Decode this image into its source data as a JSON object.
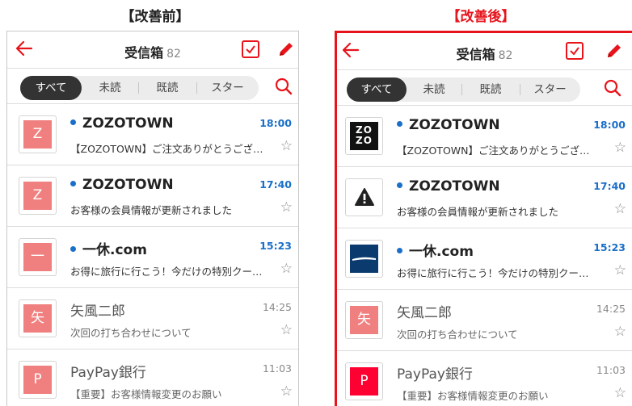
{
  "captions": {
    "before": "【改善前】",
    "after": "【改善後】"
  },
  "colors": {
    "accent": "#e8141c",
    "unread_dot": "#1a6fc9",
    "avatar_default": "#f08080",
    "paypay_brand": "#ff0033",
    "ikyu_brand": "#0b3a6e"
  },
  "header": {
    "title": "受信箱",
    "count": "82"
  },
  "filters": [
    "すべて",
    "未読",
    "既読",
    "スター"
  ],
  "before": {
    "mails": [
      {
        "initial": "Z",
        "sender": "ZOZOTOWN",
        "time": "18:00",
        "subject": "【ZOZOTOWN】ご注文ありがとうござ…"
      },
      {
        "initial": "Z",
        "sender": "ZOZOTOWN",
        "time": "17:40",
        "subject": "お客様の会員情報が更新されました"
      },
      {
        "initial": "一",
        "sender": "一休.com",
        "time": "15:23",
        "subject": "お得に旅行に行こう！今だけの特別クー…"
      },
      {
        "initial": "矢",
        "sender": "矢風二郎",
        "time": "14:25",
        "subject": "次回の打ち合わせについて"
      },
      {
        "initial": "P",
        "sender": "PayPay銀行",
        "time": "11:03",
        "subject": "【重要】お客様情報変更のお願い"
      }
    ]
  },
  "after": {
    "mails": [
      {
        "logo_text": [
          "ZO",
          "ZO"
        ],
        "sender": "ZOZOTOWN",
        "time": "18:00",
        "subject": "【ZOZOTOWN】ご注文ありがとうござ…"
      },
      {
        "icon": "warning-icon",
        "sender": "ZOZOTOWN",
        "time": "17:40",
        "subject": "お客様の会員情報が更新されました"
      },
      {
        "icon": "ikyu-logo",
        "sender": "一休.com",
        "time": "15:23",
        "subject": "お得に旅行に行こう！今だけの特別クー…"
      },
      {
        "initial": "矢",
        "sender": "矢風二郎",
        "time": "14:25",
        "subject": "次回の打ち合わせについて"
      },
      {
        "initial": "P",
        "sender": "PayPay銀行",
        "time": "11:03",
        "subject": "【重要】お客様情報変更のお願い"
      }
    ]
  }
}
